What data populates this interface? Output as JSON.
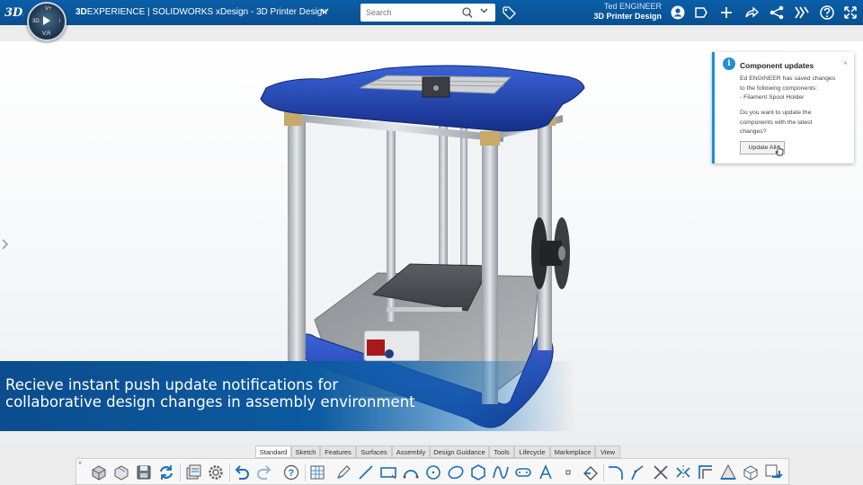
{
  "header": {
    "brand_prefix": "3D",
    "brand_mid": "EXPERIENCE | SOLIDWORKS",
    "app_suffix": " xDesign - 3D Printer Design",
    "user_name": "Ted ENGINEER",
    "workspace": "3D Printer Design",
    "logo_text": "3DS"
  },
  "compass": {
    "n": "V+",
    "w": "3D",
    "e": "i",
    "s": "V,R"
  },
  "search": {
    "placeholder": "Search"
  },
  "notification": {
    "title": "Component updates",
    "line1": "Ed ENGINEER has saved changes",
    "line2": "to the following components:",
    "line3": "- Filament Spool Holder",
    "q1": "Do you want to update the",
    "q2": "components with the latest",
    "q3": "changes?",
    "button": "Update All",
    "close": "×"
  },
  "caption": {
    "line1": "Recieve instant push update notifications for",
    "line2": "collaborative design changes in assembly environment"
  },
  "tabs": [
    "Standard",
    "Sketch",
    "Features",
    "Surfaces",
    "Assembly",
    "Design Guidance",
    "Tools",
    "Lifecycle",
    "Marketplace",
    "View"
  ],
  "active_tab": "Sketch",
  "toolbar_more": "˅",
  "colors": {
    "accent": "#0b5ea8",
    "notification_bar": "#1e8fd6",
    "printer_frame": "#1f3fa8"
  }
}
